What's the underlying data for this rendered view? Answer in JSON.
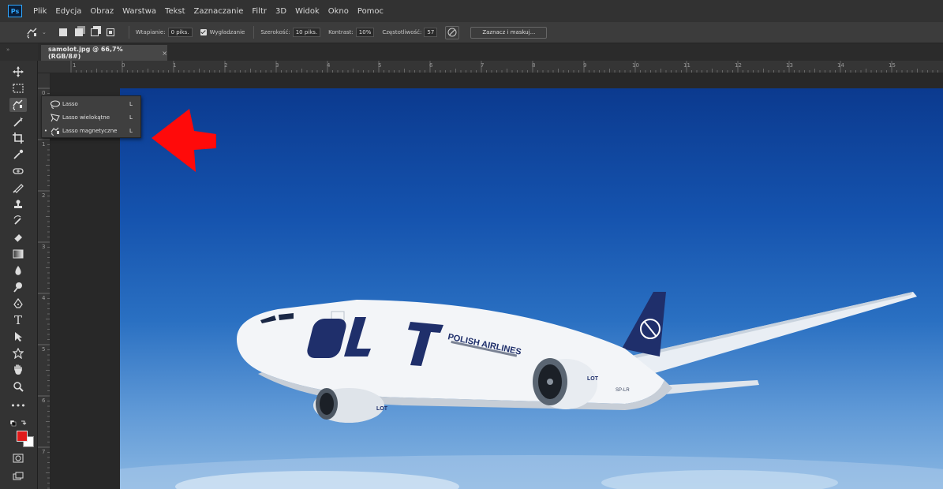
{
  "app": {
    "logo_text": "Ps"
  },
  "menu": [
    "Plik",
    "Edycja",
    "Obraz",
    "Warstwa",
    "Tekst",
    "Zaznaczanie",
    "Filtr",
    "3D",
    "Widok",
    "Okno",
    "Pomoc"
  ],
  "options": {
    "feather_label": "Wtapianie:",
    "feather_value": "0 piks.",
    "antialias_label": "Wygładzanie",
    "antialias_checked": true,
    "width_label": "Szerokość:",
    "width_value": "10 piks.",
    "contrast_label": "Kontrast:",
    "contrast_value": "10%",
    "frequency_label": "Częstotliwość:",
    "frequency_value": "57",
    "select_mask_label": "Zaznacz i maskuj..."
  },
  "document": {
    "tab_title": "samolot.jpg @ 66,7% (RGB/8#)",
    "close_glyph": "×"
  },
  "ruler_h": [
    "1",
    "0",
    "1",
    "2",
    "3",
    "4",
    "5",
    "6",
    "7",
    "8",
    "9",
    "10",
    "11",
    "12",
    "13",
    "14",
    "15"
  ],
  "ruler_v": [
    "0",
    "1",
    "2",
    "3",
    "4",
    "5",
    "6",
    "7"
  ],
  "lasso_flyout": {
    "items": [
      {
        "label": "Lasso",
        "shortcut": "L",
        "selected": false,
        "icon": "lasso-icon"
      },
      {
        "label": "Lasso wielokątne",
        "shortcut": "L",
        "selected": false,
        "icon": "polygonal-lasso-icon"
      },
      {
        "label": "Lasso magnetyczne",
        "shortcut": "L",
        "selected": true,
        "icon": "magnetic-lasso-icon"
      }
    ],
    "bullet": "•"
  },
  "photo": {
    "livery_logo": "LOT",
    "livery_text": "POLISH AIRLINES",
    "registration": "SP-LR"
  },
  "colors": {
    "foreground": "#e01a1a",
    "background": "#ffffff",
    "accent": "#31a8ff",
    "arrow": "#ff0a0a"
  },
  "tools": [
    "move-tool-icon",
    "marquee-tool-icon",
    "lasso-tool-icon",
    "magic-wand-tool-icon",
    "crop-tool-icon",
    "eyedropper-tool-icon",
    "healing-brush-tool-icon",
    "brush-tool-icon",
    "clone-stamp-tool-icon",
    "history-brush-tool-icon",
    "eraser-tool-icon",
    "gradient-tool-icon",
    "blur-tool-icon",
    "dodge-tool-icon",
    "pen-tool-icon",
    "type-tool-icon",
    "path-selection-tool-icon",
    "shape-tool-icon",
    "hand-tool-icon",
    "zoom-tool-icon",
    "more-tools-icon"
  ]
}
